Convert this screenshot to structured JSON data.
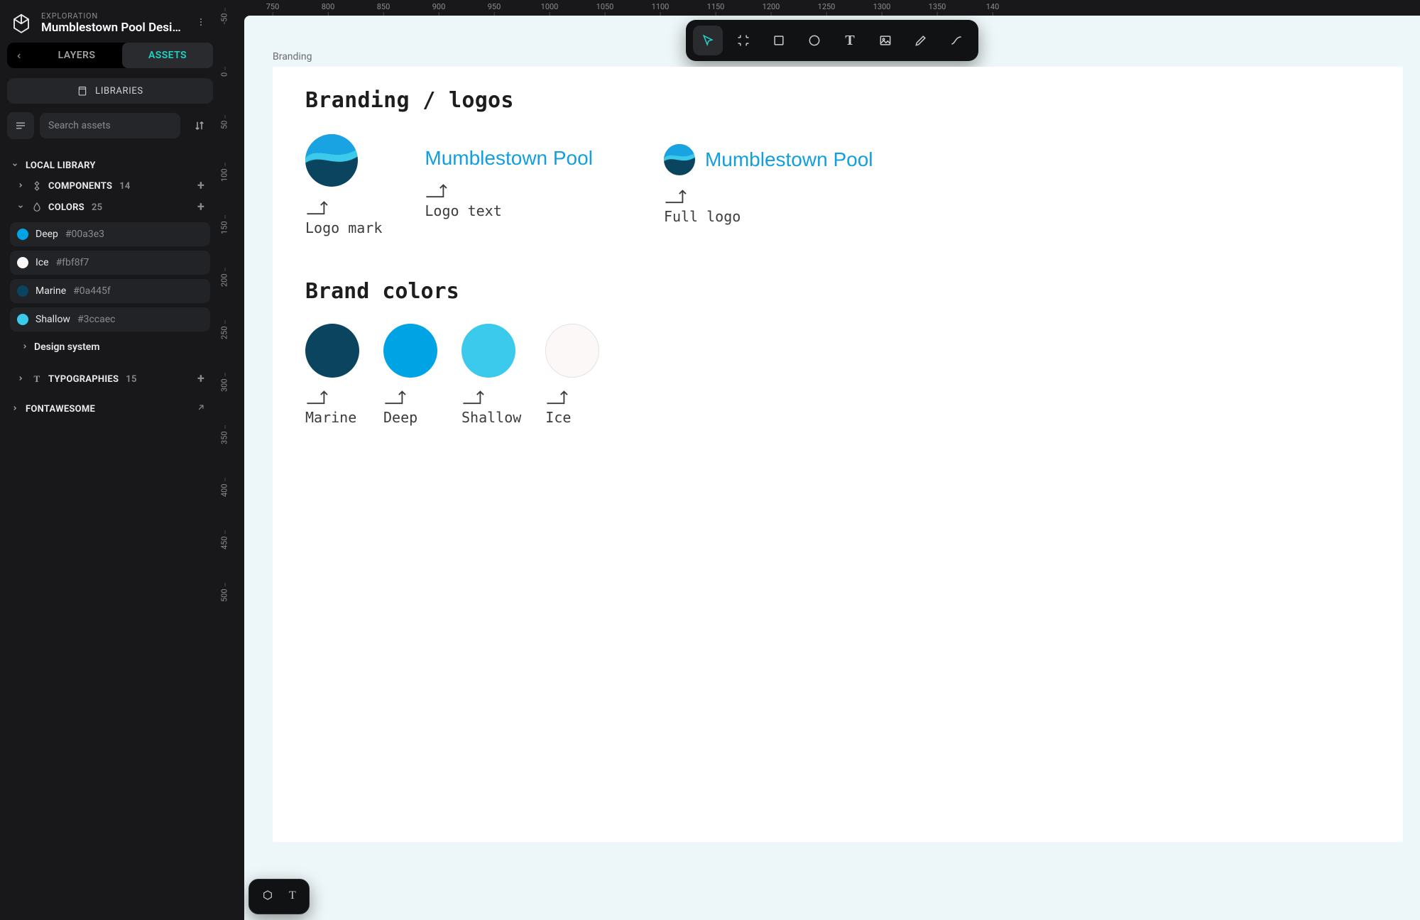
{
  "breadcrumb": {
    "parent": "EXPLORATION",
    "title": "Mumblestown Pool Desig…"
  },
  "tabs": {
    "layers": "LAYERS",
    "assets": "ASSETS"
  },
  "libraries_button": "LIBRARIES",
  "search": {
    "placeholder": "Search assets"
  },
  "sections": {
    "local_library": {
      "label": "LOCAL LIBRARY"
    },
    "components": {
      "label": "COMPONENTS",
      "count": "14"
    },
    "colors": {
      "label": "COLORS",
      "count": "25"
    },
    "design_system": {
      "label": "Design system"
    },
    "typographies": {
      "label": "TYPOGRAPHIES",
      "count": "15"
    },
    "fontawesome": {
      "label": "FONTAWESOME"
    }
  },
  "colors": [
    {
      "name": "Deep",
      "hex": "#00a3e3"
    },
    {
      "name": "Ice",
      "hex": "#fbf8f7"
    },
    {
      "name": "Marine",
      "hex": "#0a445f"
    },
    {
      "name": "Shallow",
      "hex": "#3ccaec"
    }
  ],
  "toolbar": {
    "tools": [
      "select",
      "frame",
      "rectangle",
      "ellipse",
      "text",
      "image",
      "pen",
      "curve"
    ]
  },
  "ruler": {
    "top": [
      "750",
      "800",
      "850",
      "900",
      "950",
      "1000",
      "1050",
      "1100",
      "1150",
      "1200",
      "1250",
      "1300",
      "1350",
      "140"
    ],
    "left": [
      "-50",
      "0",
      "50",
      "100",
      "150",
      "200",
      "250",
      "300",
      "350",
      "400",
      "450",
      "500"
    ]
  },
  "frame_label": "Branding",
  "canvas": {
    "heading_logos": "Branding / logos",
    "logo_text": "Mumblestown Pool",
    "anno_logo_mark": "Logo mark",
    "anno_logo_text": "Logo text",
    "anno_full_logo": "Full logo",
    "heading_colors": "Brand colors",
    "brand_colors": [
      {
        "name": "Marine",
        "hex": "#0a445f"
      },
      {
        "name": "Deep",
        "hex": "#00a3e3"
      },
      {
        "name": "Shallow",
        "hex": "#3ccaec"
      },
      {
        "name": "Ice",
        "hex": "#fbf8f7"
      }
    ]
  }
}
